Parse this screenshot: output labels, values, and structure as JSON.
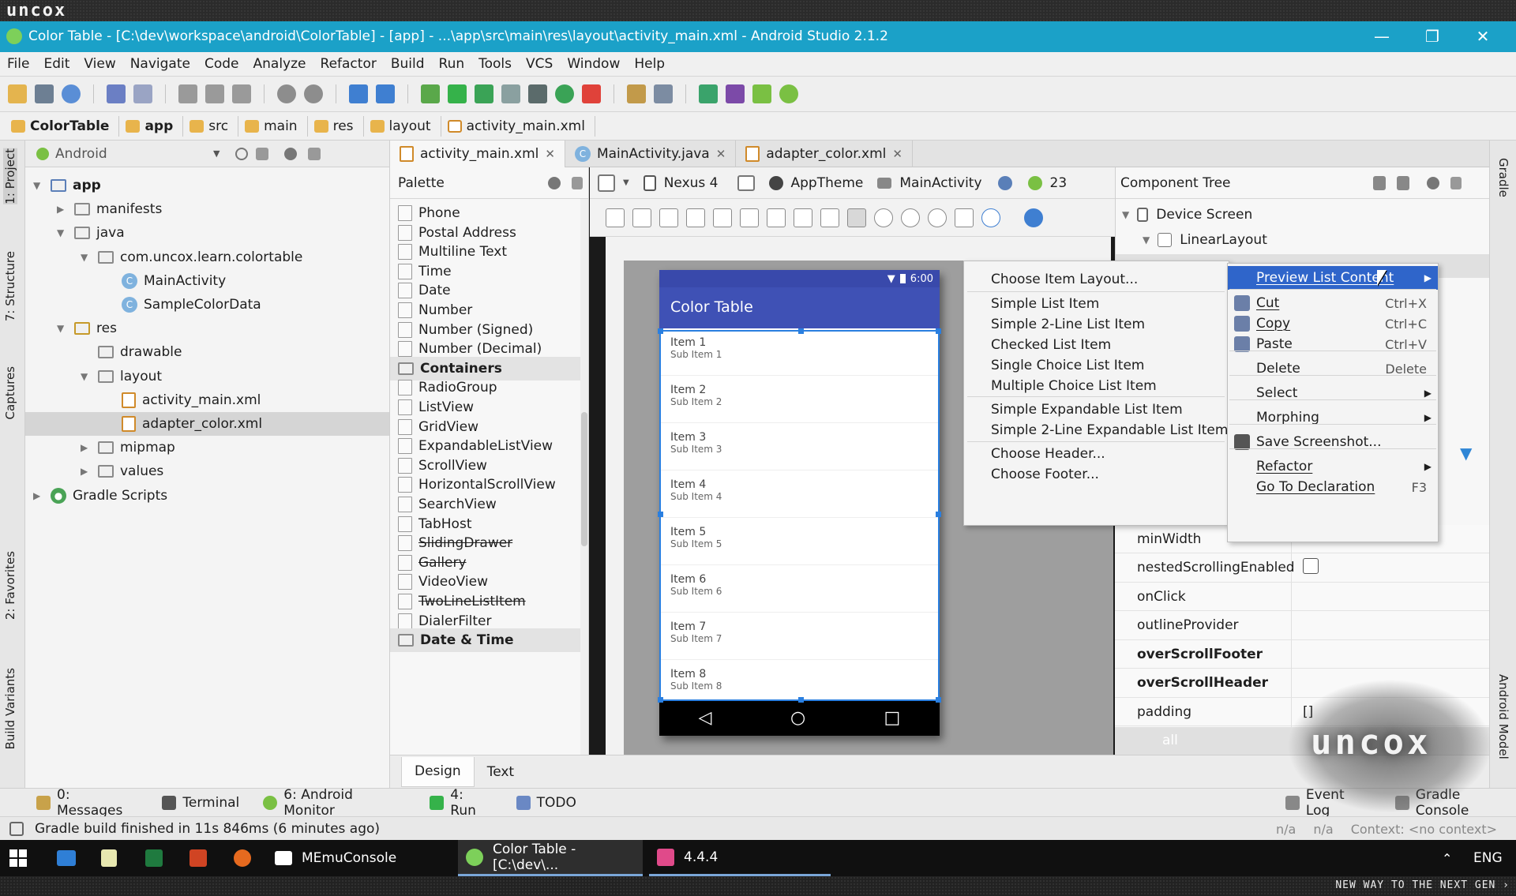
{
  "brand": "uncox",
  "window": {
    "title": "Color Table - [C:\\dev\\workspace\\android\\ColorTable] - [app] - ...\\app\\src\\main\\res\\layout\\activity_main.xml - Android Studio 2.1.2",
    "controls": [
      "—",
      "❐",
      "✕"
    ]
  },
  "menu": [
    "File",
    "Edit",
    "View",
    "Navigate",
    "Code",
    "Analyze",
    "Refactor",
    "Build",
    "Run",
    "Tools",
    "VCS",
    "Window",
    "Help"
  ],
  "breadcrumb": [
    "ColorTable",
    "app",
    "src",
    "main",
    "res",
    "layout",
    "activity_main.xml"
  ],
  "left_tabs": [
    "1: Project",
    "7: Structure",
    "Captures",
    "2: Favorites",
    "Build Variants"
  ],
  "right_tabs": [
    "Gradle",
    "Android Model"
  ],
  "project": {
    "view": "Android",
    "tree": [
      {
        "label": "app",
        "indent": 0,
        "arrow": "▼",
        "icon": "app-module-icon",
        "bold": true
      },
      {
        "label": "manifests",
        "indent": 1,
        "arrow": "▶",
        "icon": "folder-icon"
      },
      {
        "label": "java",
        "indent": 1,
        "arrow": "▼",
        "icon": "folder-icon"
      },
      {
        "label": "com.uncox.learn.colortable",
        "indent": 2,
        "arrow": "▼",
        "icon": "package-icon"
      },
      {
        "label": "MainActivity",
        "indent": 3,
        "arrow": "",
        "icon": "class-icon"
      },
      {
        "label": "SampleColorData",
        "indent": 3,
        "arrow": "",
        "icon": "class-icon"
      },
      {
        "label": "res",
        "indent": 1,
        "arrow": "▼",
        "icon": "res-folder-icon"
      },
      {
        "label": "drawable",
        "indent": 2,
        "arrow": "",
        "icon": "folder-icon"
      },
      {
        "label": "layout",
        "indent": 2,
        "arrow": "▼",
        "icon": "folder-icon"
      },
      {
        "label": "activity_main.xml",
        "indent": 3,
        "arrow": "",
        "icon": "xml-icon"
      },
      {
        "label": "adapter_color.xml",
        "indent": 3,
        "arrow": "",
        "icon": "xml-icon",
        "selected": true
      },
      {
        "label": "mipmap",
        "indent": 2,
        "arrow": "▶",
        "icon": "folder-icon"
      },
      {
        "label": "values",
        "indent": 2,
        "arrow": "▶",
        "icon": "folder-icon"
      },
      {
        "label": "Gradle Scripts",
        "indent": 0,
        "arrow": "▶",
        "icon": "gradle-icon"
      }
    ]
  },
  "editor_tabs": [
    {
      "label": "activity_main.xml",
      "active": true
    },
    {
      "label": "MainActivity.java",
      "active": false
    },
    {
      "label": "adapter_color.xml",
      "active": false
    }
  ],
  "palette": {
    "title": "Palette",
    "items": [
      {
        "label": "Phone"
      },
      {
        "label": "Postal Address"
      },
      {
        "label": "Multiline Text"
      },
      {
        "label": "Time"
      },
      {
        "label": "Date"
      },
      {
        "label": "Number"
      },
      {
        "label": "Number (Signed)"
      },
      {
        "label": "Number (Decimal)"
      },
      {
        "label": "Containers",
        "category": true
      },
      {
        "label": "RadioGroup"
      },
      {
        "label": "ListView"
      },
      {
        "label": "GridView"
      },
      {
        "label": "ExpandableListView"
      },
      {
        "label": "ScrollView"
      },
      {
        "label": "HorizontalScrollView"
      },
      {
        "label": "SearchView"
      },
      {
        "label": "TabHost"
      },
      {
        "label": "SlidingDrawer",
        "deprecated": true
      },
      {
        "label": "Gallery",
        "deprecated": true
      },
      {
        "label": "VideoView"
      },
      {
        "label": "TwoLineListItem",
        "deprecated": true
      },
      {
        "label": "DialerFilter"
      },
      {
        "label": "Date & Time",
        "category": true
      }
    ]
  },
  "designer_toolbar": {
    "device": "Nexus 4",
    "theme": "AppTheme",
    "activity": "MainActivity",
    "api": "23"
  },
  "phone": {
    "time": "6:00",
    "app_title": "Color Table",
    "items": [
      {
        "a": "Item 1",
        "b": "Sub Item 1"
      },
      {
        "a": "Item 2",
        "b": "Sub Item 2"
      },
      {
        "a": "Item 3",
        "b": "Sub Item 3"
      },
      {
        "a": "Item 4",
        "b": "Sub Item 4"
      },
      {
        "a": "Item 5",
        "b": "Sub Item 5"
      },
      {
        "a": "Item 6",
        "b": "Sub Item 6"
      },
      {
        "a": "Item 7",
        "b": "Sub Item 7"
      },
      {
        "a": "Item 8",
        "b": "Sub Item 8"
      }
    ],
    "nav": [
      "◁",
      "○",
      "□"
    ]
  },
  "component_tree": {
    "title": "Component Tree",
    "nodes": [
      "Device Screen",
      "LinearLayout"
    ]
  },
  "properties": [
    {
      "name": "minWidth",
      "value": "",
      "bold": false
    },
    {
      "name": "nestedScrollingEnabled",
      "value": "checkbox",
      "bold": false
    },
    {
      "name": "onClick",
      "value": "",
      "bold": false
    },
    {
      "name": "outlineProvider",
      "value": "",
      "bold": false
    },
    {
      "name": "overScrollFooter",
      "value": "",
      "bold": true
    },
    {
      "name": "overScrollHeader",
      "value": "",
      "bold": true
    },
    {
      "name": "padding",
      "value": "[]",
      "bold": false
    },
    {
      "name": "all",
      "value": "",
      "bold": false
    }
  ],
  "list_menu": {
    "items": [
      "Choose Item Layout...",
      "Simple List Item",
      "Simple 2-Line List Item",
      "Checked List Item",
      "Single Choice List Item",
      "Multiple Choice List Item",
      "Simple Expandable List Item",
      "Simple 2-Line Expandable List Item",
      "Choose Header...",
      "Choose Footer..."
    ]
  },
  "context_menu": {
    "items": [
      {
        "label": "Preview List Content",
        "shortcut": "",
        "submenu": true,
        "highlight": true
      },
      {
        "label": "Cut",
        "shortcut": "Ctrl+X",
        "icon": "scissors-icon"
      },
      {
        "label": "Copy",
        "shortcut": "Ctrl+C",
        "icon": "copy-icon"
      },
      {
        "label": "Paste",
        "shortcut": "Ctrl+V",
        "icon": "paste-icon"
      },
      {
        "label": "Delete",
        "shortcut": "Delete"
      },
      {
        "label": "Select",
        "shortcut": "",
        "submenu": true
      },
      {
        "label": "Morphing",
        "shortcut": "",
        "submenu": true
      },
      {
        "label": "Save Screenshot...",
        "shortcut": "",
        "icon": "camera-icon"
      },
      {
        "label": "Refactor",
        "shortcut": "",
        "submenu": true
      },
      {
        "label": "Go To Declaration",
        "shortcut": "F3"
      }
    ]
  },
  "design_tabs": [
    "Design",
    "Text"
  ],
  "tool_windows": [
    "0: Messages",
    "Terminal",
    "6: Android Monitor",
    "4: Run",
    "TODO"
  ],
  "tool_windows_right": [
    "Event Log",
    "Gradle Console"
  ],
  "status": {
    "message": "Gradle build finished in 11s 846ms (6 minutes ago)",
    "right": [
      "n/a",
      "n/a",
      "Context: <no context>"
    ]
  },
  "taskbar": {
    "apps": [
      "MEmuConsole",
      "Color Table - [C:\\dev\\...",
      "4.4.4"
    ],
    "lang": "ENG"
  },
  "tagline": "NEW WAY TO THE NEXT GEN ›",
  "colors": {
    "title_bar": "#1ba1c8",
    "highlight": "#2f65ca",
    "app_bar": "#3f51b5",
    "selection": "#2a7fe0"
  }
}
